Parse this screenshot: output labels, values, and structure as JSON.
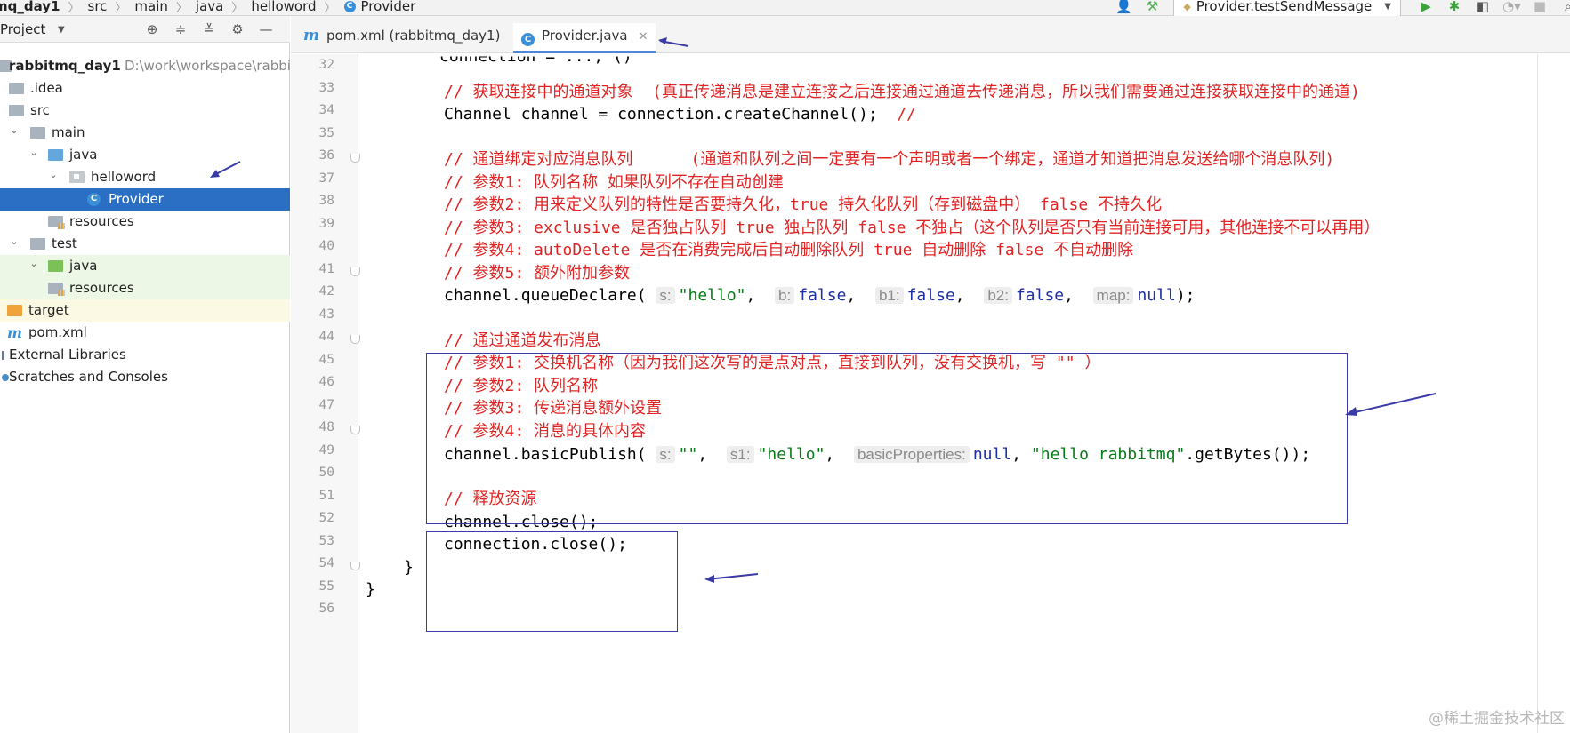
{
  "breadcrumb": [
    "mq_day1",
    "src",
    "main",
    "java",
    "helloword",
    "Provider"
  ],
  "toolbar": {
    "run_config": "Provider.testSendMessage"
  },
  "project_panel": {
    "title": "Project",
    "tree": [
      {
        "label": "rabbitmq_day1",
        "hint": "D:\\work\\workspace\\rabbitm",
        "icon": "module-folder-icon",
        "arrow": "down",
        "level": 0,
        "style": "bold"
      },
      {
        "label": ".idea",
        "icon": "folder-icon",
        "arrow": "",
        "level": 1
      },
      {
        "label": "src",
        "icon": "folder-icon",
        "arrow": "",
        "level": 1
      },
      {
        "label": "main",
        "icon": "folder-icon",
        "arrow": "down",
        "level": 1
      },
      {
        "label": "java",
        "icon": "source-folder-icon",
        "arrow": "down",
        "level": 2
      },
      {
        "label": "helloword",
        "icon": "package-icon",
        "arrow": "down",
        "level": 3
      },
      {
        "label": "Provider",
        "icon": "class-icon",
        "arrow": "",
        "level": 4,
        "style": "selected"
      },
      {
        "label": "resources",
        "icon": "resources-folder-icon",
        "arrow": "",
        "level": 2
      },
      {
        "label": "test",
        "icon": "folder-icon",
        "arrow": "down",
        "level": 1
      },
      {
        "label": "java",
        "icon": "test-folder-icon",
        "arrow": "down",
        "level": 2,
        "style": "test"
      },
      {
        "label": "resources",
        "icon": "resources-folder-icon",
        "arrow": "",
        "level": 2,
        "style": "test"
      },
      {
        "label": "target",
        "icon": "excluded-folder-icon",
        "arrow": "",
        "level": 0,
        "style": "target"
      },
      {
        "label": "pom.xml",
        "icon": "maven-file-icon",
        "arrow": "",
        "level": 0
      },
      {
        "label": "External Libraries",
        "icon": "library-icon",
        "arrow": "",
        "level": 0
      },
      {
        "label": "Scratches and Consoles",
        "icon": "scratches-icon",
        "arrow": "",
        "level": 0
      }
    ]
  },
  "tabs": [
    {
      "label": "pom.xml (rabbitmq_day1)",
      "icon": "m-icon",
      "active": false
    },
    {
      "label": "Provider.java",
      "icon": "class-icon",
      "active": true
    }
  ],
  "line_numbers": [
    "32",
    "33",
    "34",
    "35",
    "36",
    "37",
    "38",
    "39",
    "40",
    "41",
    "42",
    "43",
    "44",
    "45",
    "46",
    "47",
    "48",
    "49",
    "50",
    "51",
    "52",
    "53",
    "54",
    "55",
    "56"
  ],
  "code": {
    "top_cut": "connection = ...;   ()",
    "l33_comment": "// 获取连接中的通道对象  (真正传递消息是建立连接之后连接通过通道去传递消息，所以我们需要通过连接获取连接中的通道)",
    "l34_code": "Channel channel = connection.createChannel();  ",
    "l34_comment": "//",
    "l36_comment": "// 通道绑定对应消息队列      (通道和队列之间一定要有一个声明或者一个绑定，通道才知道把消息发送给哪个消息队列)",
    "l37_comment": "// 参数1: 队列名称 如果队列不存在自动创建",
    "l38_comment": "// 参数2: 用来定义队列的特性是否要持久化，true 持久化队列（存到磁盘中） false 不持久化",
    "l39_comment": "// 参数3: exclusive 是否独占队列 true 独占队列 false 不独占（这个队列是否只有当前连接可用，其他连接不可以再用）",
    "l40_comment": "// 参数4: autoDelete 是否在消费完成后自动删除队列 true 自动删除 false 不自动删除",
    "l41_comment": "// 参数5: 额外附加参数",
    "l42": {
      "prefix": "channel.queueDeclare(",
      "h1": "s:",
      "a1": "\"hello\"",
      "sep1": ", ",
      "h2": "b:",
      "a2": "false",
      "sep2": ", ",
      "h3": "b1:",
      "a3": "false",
      "sep3": ", ",
      "h4": "b2:",
      "a4": "false",
      "sep4": ", ",
      "h5": "map:",
      "a5": "null",
      "suffix": ");"
    },
    "l44_comment": "// 通过通道发布消息",
    "l45_comment": "// 参数1: 交换机名称（因为我们这次写的是点对点，直接到队列，没有交换机，写 \"\" ）",
    "l46_comment": "// 参数2: 队列名称",
    "l47_comment": "// 参数3: 传递消息额外设置",
    "l48_comment": "// 参数4: 消息的具体内容",
    "l49": {
      "prefix": "channel.basicPublish(",
      "h1": "s:",
      "a1": "\"\"",
      "sep1": ", ",
      "h2": "s1:",
      "a2": "\"hello\"",
      "sep2": ", ",
      "h3": "basicProperties:",
      "a3": "null",
      "sep3": ", ",
      "a4": "\"hello rabbitmq\"",
      "suffix": ".getBytes());"
    },
    "l51_comment": "// 释放资源",
    "l52_code": "channel.close();",
    "l53_code": "connection.close();",
    "l54_code": "}",
    "l55_code": "}"
  },
  "watermark": "@稀土掘金技术社区",
  "annotation_color": "#3b3ba8"
}
